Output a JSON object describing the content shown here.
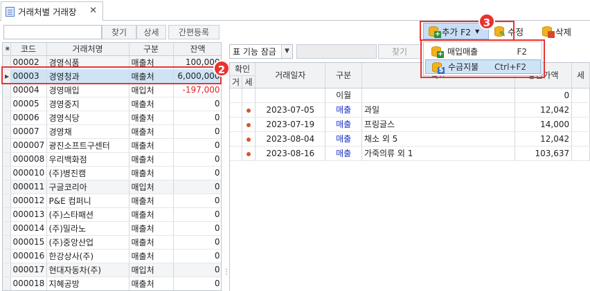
{
  "tab": {
    "title": "거래처별 거래장",
    "close": "✕"
  },
  "left_toolbar": {
    "search_value": "",
    "find": "찾기",
    "detail": "상세",
    "quick_reg": "간편등록"
  },
  "left_grid": {
    "corner": "⋇",
    "columns": [
      "코드",
      "거래처명",
      "구분",
      "잔액"
    ],
    "rows": [
      {
        "code": "00002",
        "name": "경영식품",
        "type": "매출처",
        "balance": "100,000"
      },
      {
        "code": "00003",
        "name": "경영청과",
        "type": "매출처",
        "balance": "6,000,000"
      },
      {
        "code": "00004",
        "name": "경영매입",
        "type": "매입처",
        "balance": "-197,000"
      },
      {
        "code": "00005",
        "name": "경영중지",
        "type": "매출처",
        "balance": "0"
      },
      {
        "code": "00006",
        "name": "경영식당",
        "type": "매출처",
        "balance": "0"
      },
      {
        "code": "00007",
        "name": "경영채",
        "type": "매출처",
        "balance": "0"
      },
      {
        "code": "000007",
        "name": "광진소프트구센터",
        "type": "매출처",
        "balance": "0"
      },
      {
        "code": "000008",
        "name": "우리백화점",
        "type": "매출처",
        "balance": "0"
      },
      {
        "code": "000010",
        "name": "(주)병진캠",
        "type": "매출처",
        "balance": "0"
      },
      {
        "code": "000011",
        "name": "구글코리아",
        "type": "매입처",
        "balance": "0"
      },
      {
        "code": "000012",
        "name": "P&E 컴퍼니",
        "type": "매출처",
        "balance": "0"
      },
      {
        "code": "000013",
        "name": "(주)스타패션",
        "type": "매출처",
        "balance": "0"
      },
      {
        "code": "000014",
        "name": "(주)밀라노",
        "type": "매출처",
        "balance": "0"
      },
      {
        "code": "000015",
        "name": "(주)중앙산업",
        "type": "매출처",
        "balance": "0"
      },
      {
        "code": "000016",
        "name": "한강상사(주)",
        "type": "매출처",
        "balance": "0"
      },
      {
        "code": "000017",
        "name": "현대자동차(주)",
        "type": "매입처",
        "balance": "0"
      },
      {
        "code": "000018",
        "name": "지혜공방",
        "type": "매출처",
        "balance": "0"
      }
    ]
  },
  "right_toolbar": {
    "add": "추가 F2",
    "edit": "수정",
    "delete": "삭제",
    "filter_combo": "표 기능 잠금",
    "find": "찾기"
  },
  "add_menu": [
    {
      "label": "매입매출",
      "key": "F2"
    },
    {
      "label": "수금지불",
      "key": "Ctrl+F2"
    }
  ],
  "right_grid": {
    "group_header": "확인",
    "columns": [
      "거",
      "세",
      "거래일자",
      "구분",
      "적요",
      "공급가액",
      "세"
    ],
    "rows": [
      {
        "g": "",
        "s": "",
        "date": "",
        "type": "이월",
        "desc": "",
        "amount": "0",
        "dot": false
      },
      {
        "g": "",
        "s": "",
        "date": "2023-07-05",
        "type": "매출",
        "desc": "과일",
        "amount": "12,042",
        "dot": true
      },
      {
        "g": "",
        "s": "",
        "date": "2023-07-19",
        "type": "매출",
        "desc": "프링글스",
        "amount": "14,000",
        "dot": true
      },
      {
        "g": "",
        "s": "",
        "date": "2023-08-04",
        "type": "매출",
        "desc": "채소 외 5",
        "amount": "12,042",
        "dot": true
      },
      {
        "g": "",
        "s": "",
        "date": "2023-08-16",
        "type": "매출",
        "desc": "가죽의류 외 1",
        "amount": "103,637",
        "dot": true
      }
    ]
  },
  "badges": {
    "b2": "2",
    "b3": "3"
  },
  "colors": {
    "accent_red": "#e8332f",
    "selection": "#cfe3f7",
    "negative": "#e02020",
    "sale_blue": "#1a35c8"
  }
}
